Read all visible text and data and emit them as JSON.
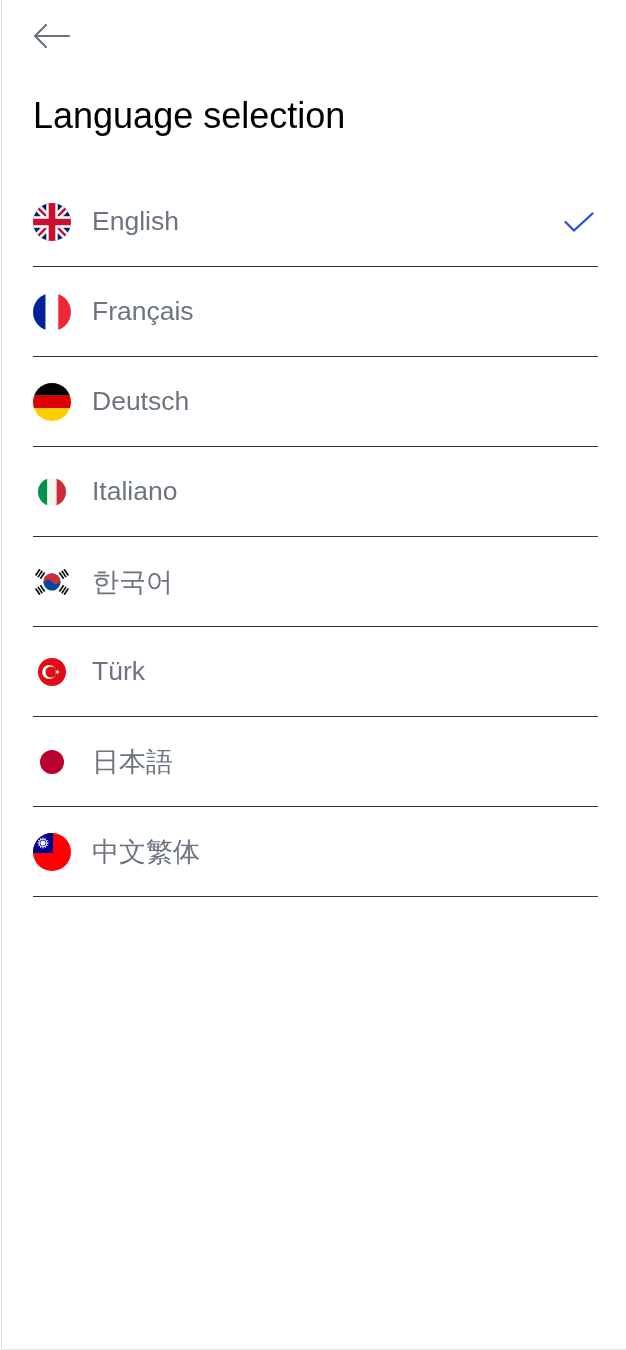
{
  "title": "Language selection",
  "languages": [
    {
      "label": "English",
      "kind": "uk",
      "selected": true
    },
    {
      "label": "Français",
      "kind": "france",
      "selected": false
    },
    {
      "label": "Deutsch",
      "kind": "germany",
      "selected": false
    },
    {
      "label": "Italiano",
      "kind": "italy",
      "selected": false
    },
    {
      "label": "한국어",
      "kind": "korea",
      "selected": false
    },
    {
      "label": "Türk",
      "kind": "turkey",
      "selected": false
    },
    {
      "label": "日本語",
      "kind": "japan",
      "selected": false
    },
    {
      "label": "中文繁体",
      "kind": "taiwan",
      "selected": false
    }
  ]
}
